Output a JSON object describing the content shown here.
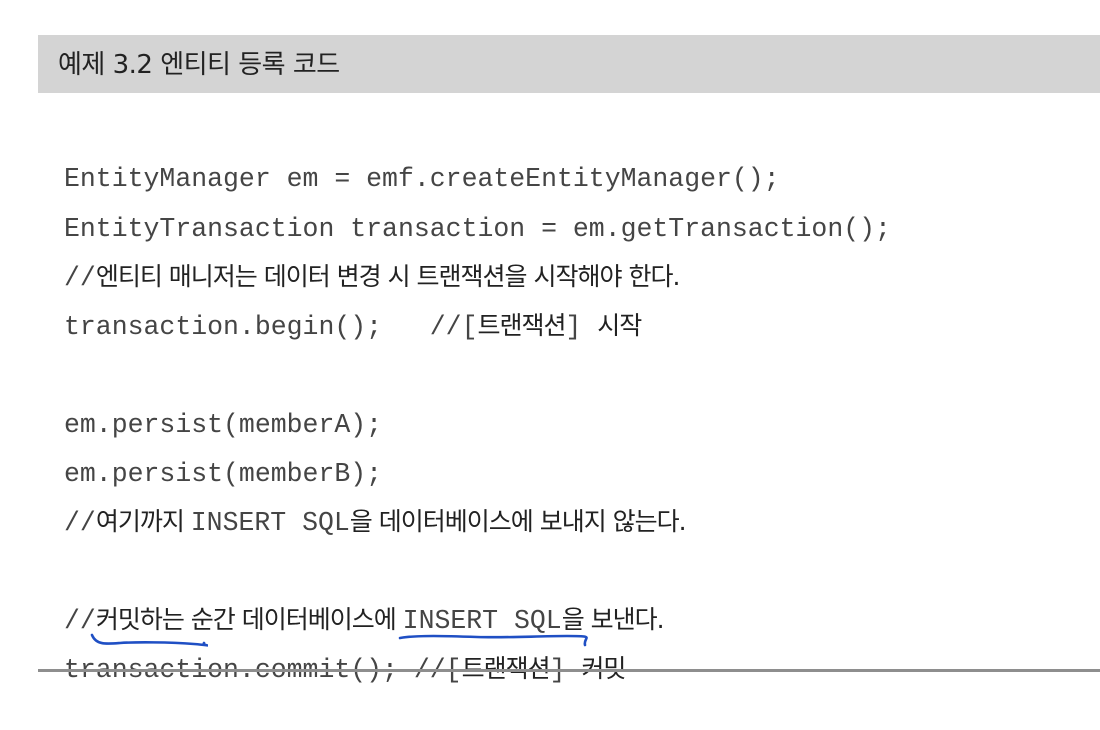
{
  "header": {
    "title": "예제 3.2  엔티티 등록 코드"
  },
  "code": {
    "line1": "EntityManager em = emf.createEntityManager();",
    "line2": "EntityTransaction transaction = em.getTransaction();",
    "line3_slashes": "//",
    "line3_comment": "엔티티 매니저는 데이터 변경 시 트랜잭션을 시작해야 한다.",
    "line4_code": "transaction.begin();   //[",
    "line4_ko1": "트랜잭션",
    "line4_bracket": "] ",
    "line4_ko2": "시작",
    "line5": "em.persist(memberA);",
    "line6": "em.persist(memberB);",
    "line7_slashes": "//",
    "line7_ko1": "여기까지 ",
    "line7_sql": "INSERT SQL",
    "line7_ko2": "을 데이터베이스에 보내지 않는다.",
    "line8_slashes": "//",
    "line8_ko1": "커밋하는",
    "line8_ko2": " 순간 데이터베이스에 ",
    "line8_sql": "INSERT SQL",
    "line8_ko3": "을 보낸다.",
    "line9_code": "transaction.commit(); //[",
    "line9_ko1": "트랜잭션",
    "line9_bracket": "] ",
    "line9_ko2": "커밋"
  },
  "annotation": {
    "ink_color": "#1f4fc4"
  }
}
